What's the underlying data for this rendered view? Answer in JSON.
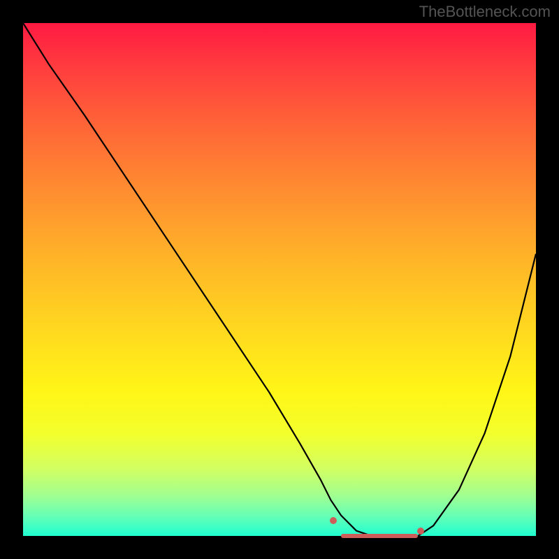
{
  "watermark": "TheBottleneck.com",
  "chart_data": {
    "type": "line",
    "title": "",
    "xlabel": "",
    "ylabel": "",
    "xlim": [
      0,
      100
    ],
    "ylim": [
      0,
      100
    ],
    "series": [
      {
        "name": "curve",
        "x": [
          0,
          5,
          12,
          20,
          30,
          40,
          48,
          54,
          58,
          60,
          62,
          65,
          68,
          72,
          75,
          77,
          80,
          85,
          90,
          95,
          100
        ],
        "y": [
          100,
          92,
          82,
          70,
          55,
          40,
          28,
          18,
          11,
          7,
          4,
          1,
          0,
          0,
          0,
          0,
          2,
          9,
          20,
          35,
          55
        ]
      }
    ],
    "highlight": {
      "flat_start_x": 62,
      "flat_end_x": 77,
      "flat_y": 0,
      "dots": [
        {
          "x": 60.5,
          "y": 3
        },
        {
          "x": 77.5,
          "y": 1
        }
      ]
    }
  }
}
